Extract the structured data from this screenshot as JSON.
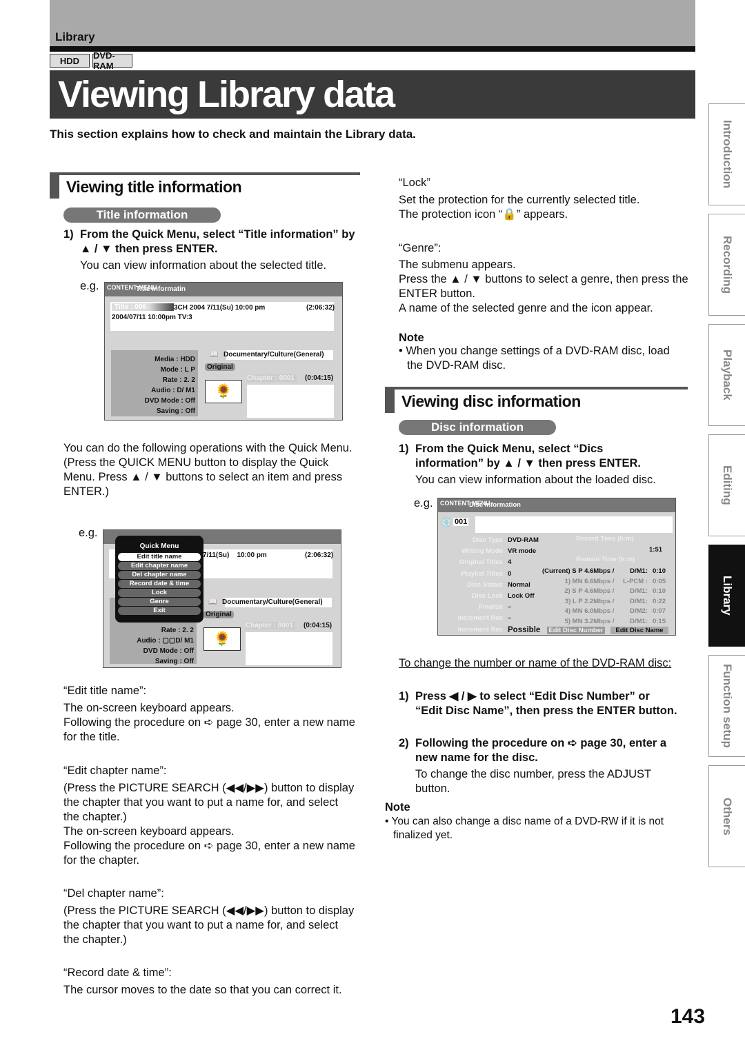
{
  "header": {
    "section": "Library",
    "media_tabs": [
      "HDD",
      "DVD-RAM"
    ],
    "title": "Viewing Library data",
    "intro": "This section explains how to check and maintain the Library data."
  },
  "side_tabs": [
    {
      "label": "Introduction",
      "active": false
    },
    {
      "label": "Recording",
      "active": false
    },
    {
      "label": "Playback",
      "active": false
    },
    {
      "label": "Editing",
      "active": false
    },
    {
      "label": "Library",
      "active": true
    },
    {
      "label": "Function setup",
      "active": false
    },
    {
      "label": "Others",
      "active": false
    }
  ],
  "left": {
    "section_title": "Viewing title information",
    "pill": "Title information",
    "step1_num": "1)",
    "step1": "From the Quick Menu, select “Title information” by ▲ / ▼ then press ENTER.",
    "step1_desc": "You can view information about the selected title.",
    "eg": "e.g.",
    "screen1": {
      "logo": "CONTENT MENU",
      "title": "Title informatin",
      "title_no": "Title : 006",
      "header_info": "3CH   2004   7/11(Su)   10:00 pm",
      "duration": "(2:06:32)",
      "sub": "2004/07/11  10:00pm  TV:3",
      "fields": [
        [
          "Media :",
          "HDD"
        ],
        [
          "Mode :",
          "L P"
        ],
        [
          "Rate :",
          "2. 2"
        ],
        [
          "Audio :",
          "D/ M1"
        ],
        [
          "DVD Mode :",
          "Off"
        ],
        [
          "Saving :",
          "Off"
        ]
      ],
      "genre": "Documentary/Culture(General)",
      "original": "Original",
      "chapter": "Chapter :  0001",
      "chapter_time": "(0:04:15)"
    },
    "para1": "You can do the following operations with the Quick Menu.\n(Press the QUICK MENU button to display the Quick Menu. Press ▲ / ▼ buttons to select an item and press ENTER.)",
    "quick_menu": {
      "title": "Quick Menu",
      "items": [
        "Edit title name",
        "Edit chapter name",
        "Del chapter name",
        "Record date & time",
        "Lock",
        "Genre",
        "Exit"
      ],
      "selected": 0
    },
    "items": [
      {
        "head": "“Edit title name”:",
        "body": "The on-screen keyboard appears.\nFollowing the procedure on ➪ page 30, enter a new name for the title."
      },
      {
        "head": "“Edit chapter name”:",
        "body": "(Press the PICTURE SEARCH (◀◀/▶▶) button to display the chapter that you want to put a name for, and select the chapter.)\nThe on-screen keyboard appears.\nFollowing the procedure on ➪ page 30, enter a new name for the chapter."
      },
      {
        "head": "“Del chapter name”:",
        "body": "(Press the PICTURE SEARCH (◀◀/▶▶) button to display the chapter that you want to put a name for, and select the chapter.)"
      },
      {
        "head": "“Record date & time”:",
        "body": "The cursor moves to the date so that you can correct it."
      }
    ]
  },
  "right": {
    "lock_head": "“Lock”",
    "lock_body": "Set the protection for the currently selected title.\nThe protection icon “🔒” appears.",
    "genre_head": "“Genre”:",
    "genre_body": "The submenu appears.\nPress the ▲ / ▼ buttons to select a genre, then press the ENTER button.\nA name of the selected genre and the icon appear.",
    "note1_head": "Note",
    "note1": "• When you change settings of a DVD-RAM disc, load the DVD-RAM disc.",
    "section_title": "Viewing disc information",
    "pill": "Disc information",
    "step1_num": "1)",
    "step1": "From the Quick Menu, select “Dics information” by ▲ / ▼ then press ENTER.",
    "step1_desc": "You can view information about the loaded disc.",
    "eg": "e.g.",
    "screen2": {
      "logo": "CONTENT MENU",
      "title": "Disc information",
      "disc_no": "001",
      "labels": [
        "Disc Type",
        "Writing Mode",
        "Original Titles",
        "Playlist Titles",
        "Disc Status",
        "Disc Lock",
        "Finalize",
        "Increment Rec",
        "Increment Rec"
      ],
      "values": [
        "DVD-RAM",
        "VR mode",
        "4",
        "0",
        "Normal",
        "Lock Off",
        "–",
        "–",
        "Possible"
      ],
      "record_time_label": "Record Time (h:m)",
      "record_time": "1:51",
      "remain_label": "Remain Time (h:m)",
      "modes": [
        [
          "(Current) S P 4.6Mbps / ",
          "D/M1:",
          "0:10"
        ],
        [
          "1) MN 6.6Mbps / ",
          "L-PCM  :",
          "0:05"
        ],
        [
          "2) S P 4.6Mbps / ",
          "D/M1:",
          "0:10"
        ],
        [
          "3)  L P 2.2Mbps / ",
          "D/M1:",
          "0:22"
        ],
        [
          "4) MN 6.0Mbps / ",
          "D/M2:",
          "0:07"
        ],
        [
          "5) MN 3.2Mbps / ",
          "D/M1:",
          "0:15"
        ]
      ],
      "btn_number": "Edit Disc Number",
      "btn_name": "Edit Disc Name"
    },
    "link": "To change the number or name of the DVD-RAM disc:",
    "s1_num": "1)",
    "s1": "Press ◀ / ▶ to select “Edit Disc Number” or “Edit Disc Name”, then press the ENTER button.",
    "s2_num": "2)",
    "s2": "Following the procedure on ➪ page 30, enter a new name for the disc.",
    "s2_desc": "To change the disc number, press the ADJUST button.",
    "note2_head": "Note",
    "note2": "• You can also change a disc name of a DVD-RW if it is not finalized yet."
  },
  "page_number": "143"
}
